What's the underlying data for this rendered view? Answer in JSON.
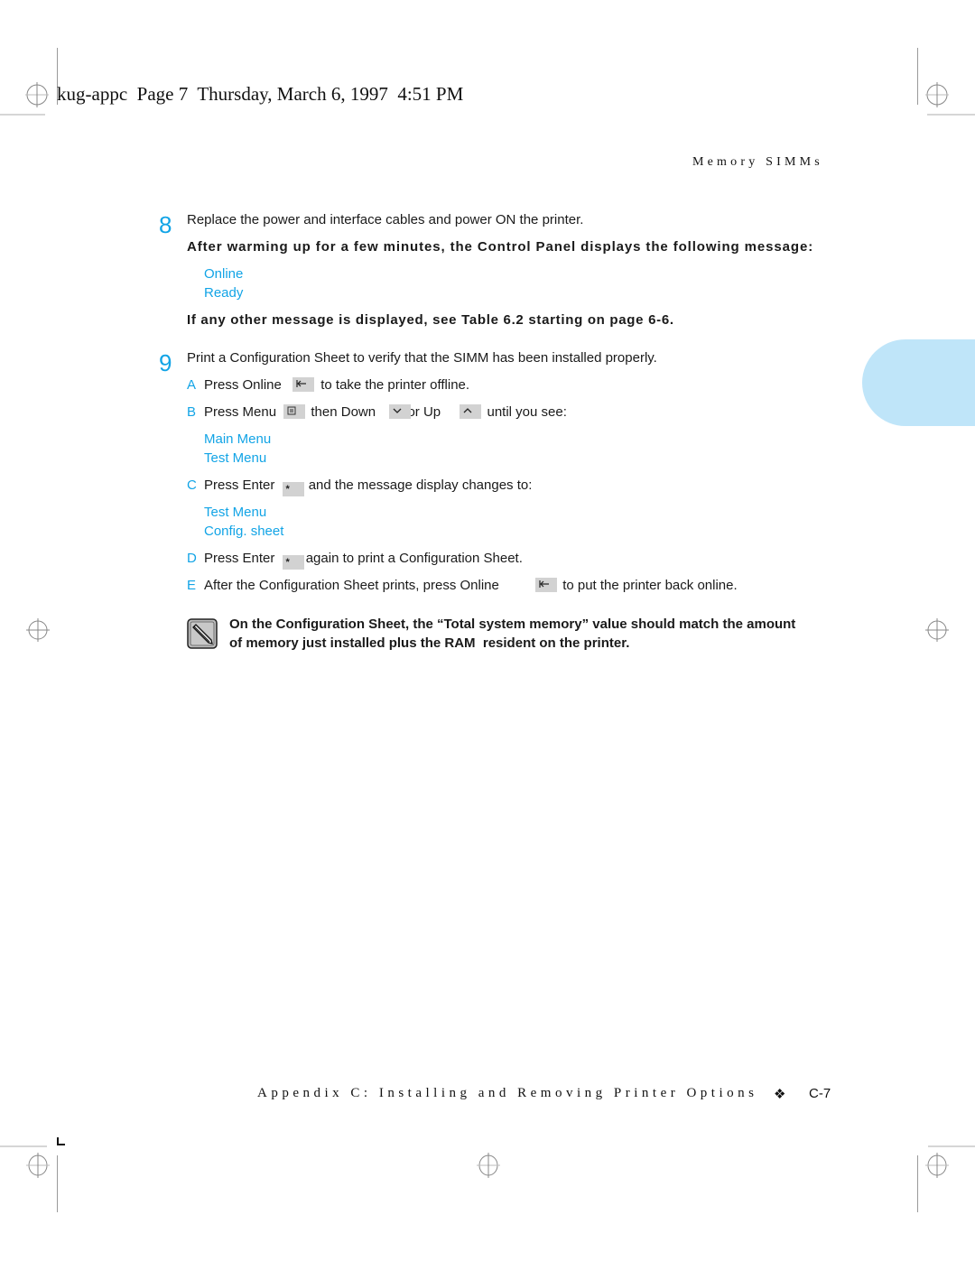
{
  "header": {
    "slug": "kug-appc  Page 7  Thursday, March 6, 1997  4:51 PM",
    "running_head": "Memory SIMMs"
  },
  "step8": {
    "number": "8",
    "text": "Replace the power and interface cables and power ON the printer.",
    "bold_intro": "After warming up for a few minutes, the Control Panel displays the following message:",
    "display_lines": [
      "Online",
      "Ready"
    ],
    "bold_note": "If any other message is displayed, see Table 6.2 starting on page 6-6."
  },
  "step9": {
    "number": "9",
    "text": "Print a Configuration Sheet to verify that the SIMM has been installed properly.",
    "substeps": {
      "A": {
        "letter": "A",
        "before": "Press Online",
        "key": "online-key",
        "after": "to take the printer offline."
      },
      "B": {
        "letter": "B",
        "before": "Press Menu",
        "middle1": "then Down",
        "middle2": "or Up",
        "after": "until you see:",
        "display_lines": [
          "Main Menu",
          "Test Menu"
        ]
      },
      "C": {
        "letter": "C",
        "before": "Press Enter",
        "after": "and the message display changes to:",
        "display_lines": [
          "Test Menu",
          "Config. sheet"
        ]
      },
      "D": {
        "letter": "D",
        "before": "Press Enter",
        "after": "again to print a Configuration Sheet."
      },
      "E": {
        "letter": "E",
        "before": "After the Configuration Sheet prints, press Online",
        "after": "to put the printer back online."
      }
    }
  },
  "note": {
    "icon": "pencil-icon",
    "line1": "On the Configuration Sheet, the “Total system memory” value should match the amount",
    "line2": "of memory just installed plus the RAM  resident on the printer."
  },
  "footer": {
    "chapter": "Appendix C: Installing and Removing Printer Options",
    "separator": "❖",
    "page": "C-7"
  },
  "colors": {
    "accent": "#12a4e6",
    "tab": "#bfe5f9",
    "key_bg": "#d2d2d2"
  }
}
